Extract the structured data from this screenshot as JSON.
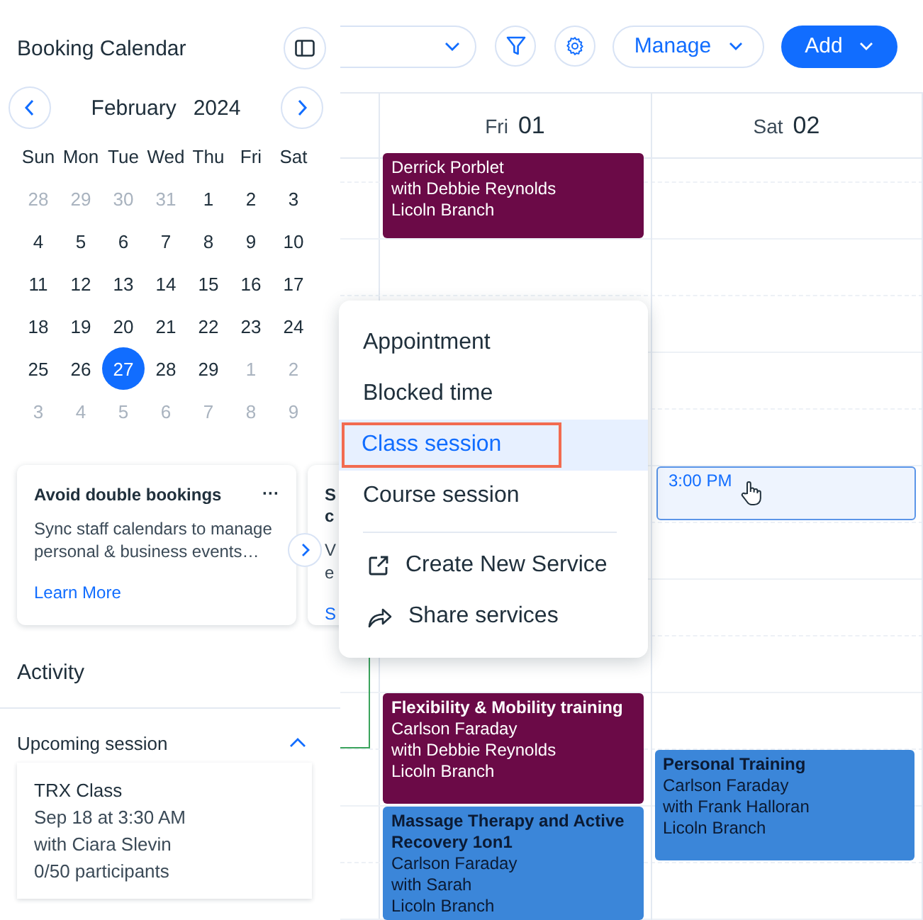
{
  "sidebar": {
    "title": "Booking Calendar",
    "month": "February",
    "year": "2024",
    "weekdays": [
      "Sun",
      "Mon",
      "Tue",
      "Wed",
      "Thu",
      "Fri",
      "Sat"
    ],
    "weeks": [
      [
        {
          "label": "28",
          "in_month": false,
          "selected": false
        },
        {
          "label": "29",
          "in_month": false,
          "selected": false
        },
        {
          "label": "30",
          "in_month": false,
          "selected": false
        },
        {
          "label": "31",
          "in_month": false,
          "selected": false
        },
        {
          "label": "1",
          "in_month": true,
          "selected": false
        },
        {
          "label": "2",
          "in_month": true,
          "selected": false
        },
        {
          "label": "3",
          "in_month": true,
          "selected": false
        }
      ],
      [
        {
          "label": "4",
          "in_month": true,
          "selected": false
        },
        {
          "label": "5",
          "in_month": true,
          "selected": false
        },
        {
          "label": "6",
          "in_month": true,
          "selected": false
        },
        {
          "label": "7",
          "in_month": true,
          "selected": false
        },
        {
          "label": "8",
          "in_month": true,
          "selected": false
        },
        {
          "label": "9",
          "in_month": true,
          "selected": false
        },
        {
          "label": "10",
          "in_month": true,
          "selected": false
        }
      ],
      [
        {
          "label": "11",
          "in_month": true,
          "selected": false
        },
        {
          "label": "12",
          "in_month": true,
          "selected": false
        },
        {
          "label": "13",
          "in_month": true,
          "selected": false
        },
        {
          "label": "14",
          "in_month": true,
          "selected": false
        },
        {
          "label": "15",
          "in_month": true,
          "selected": false
        },
        {
          "label": "16",
          "in_month": true,
          "selected": false
        },
        {
          "label": "17",
          "in_month": true,
          "selected": false
        }
      ],
      [
        {
          "label": "18",
          "in_month": true,
          "selected": false
        },
        {
          "label": "19",
          "in_month": true,
          "selected": false
        },
        {
          "label": "20",
          "in_month": true,
          "selected": false
        },
        {
          "label": "21",
          "in_month": true,
          "selected": false
        },
        {
          "label": "22",
          "in_month": true,
          "selected": false
        },
        {
          "label": "23",
          "in_month": true,
          "selected": false
        },
        {
          "label": "24",
          "in_month": true,
          "selected": false
        }
      ],
      [
        {
          "label": "25",
          "in_month": true,
          "selected": false
        },
        {
          "label": "26",
          "in_month": true,
          "selected": false
        },
        {
          "label": "27",
          "in_month": true,
          "selected": true
        },
        {
          "label": "28",
          "in_month": true,
          "selected": false
        },
        {
          "label": "29",
          "in_month": true,
          "selected": false
        },
        {
          "label": "1",
          "in_month": false,
          "selected": false
        },
        {
          "label": "2",
          "in_month": false,
          "selected": false
        }
      ],
      [
        {
          "label": "3",
          "in_month": false,
          "selected": false
        },
        {
          "label": "4",
          "in_month": false,
          "selected": false
        },
        {
          "label": "5",
          "in_month": false,
          "selected": false
        },
        {
          "label": "6",
          "in_month": false,
          "selected": false
        },
        {
          "label": "7",
          "in_month": false,
          "selected": false
        },
        {
          "label": "8",
          "in_month": false,
          "selected": false
        },
        {
          "label": "9",
          "in_month": false,
          "selected": false
        }
      ]
    ],
    "cards": [
      {
        "title_lines": [
          "Avoid double bookings"
        ],
        "more": "···",
        "text_lines": [
          "Sync staff calendars to manage",
          "personal & business events…"
        ],
        "link": "Learn More"
      },
      {
        "title_lines": [
          "S",
          "c"
        ],
        "text_lines": [
          "V",
          "e"
        ],
        "link": "S"
      }
    ],
    "activity": {
      "title": "Activity",
      "section": "Upcoming session",
      "expanded": true,
      "session": {
        "name": "TRX Class",
        "lines": [
          "Sep 18 at 3:30 AM",
          "with Ciara Slevin",
          "0/50 participants"
        ]
      }
    }
  },
  "toolbar": {
    "manage": "Manage",
    "add": "Add"
  },
  "columns": [
    {
      "day": "Fri",
      "date": "01",
      "events": [
        {
          "kind": "booking",
          "color": "#6b0a47",
          "lines": [
            "Derrick Porblet",
            "with Debbie Reynolds",
            "Licoln Branch"
          ]
        },
        {
          "kind": "booking",
          "color": "#6b0a47",
          "title": "Flexibility & Mobility training",
          "lines": [
            "Carlson Faraday",
            "with Debbie Reynolds",
            "Licoln Branch"
          ]
        },
        {
          "kind": "booking",
          "color": "#3b86d9",
          "title": "Massage Therapy and Active Recovery 1on1",
          "lines": [
            "Carlson Faraday",
            "with Sarah",
            "Licoln Branch"
          ]
        }
      ]
    },
    {
      "day": "Sat",
      "date": "02",
      "events": [
        {
          "kind": "slot",
          "time": "3:00 PM"
        },
        {
          "kind": "booking",
          "color": "#3b86d9",
          "title": "Personal Training",
          "lines": [
            "Carlson Faraday",
            "with Frank Halloran",
            "Licoln Branch"
          ]
        }
      ]
    }
  ],
  "menu": {
    "items": [
      {
        "label": "Appointment",
        "kind": "option",
        "selected": false
      },
      {
        "label": "Blocked time",
        "kind": "option",
        "selected": false
      },
      {
        "label": "Class session",
        "kind": "option",
        "selected": true
      },
      {
        "label": "Course session",
        "kind": "option",
        "selected": false
      },
      {
        "label": "Create New Service",
        "kind": "external",
        "selected": false
      },
      {
        "label": "Share services",
        "kind": "share",
        "selected": false
      }
    ]
  }
}
